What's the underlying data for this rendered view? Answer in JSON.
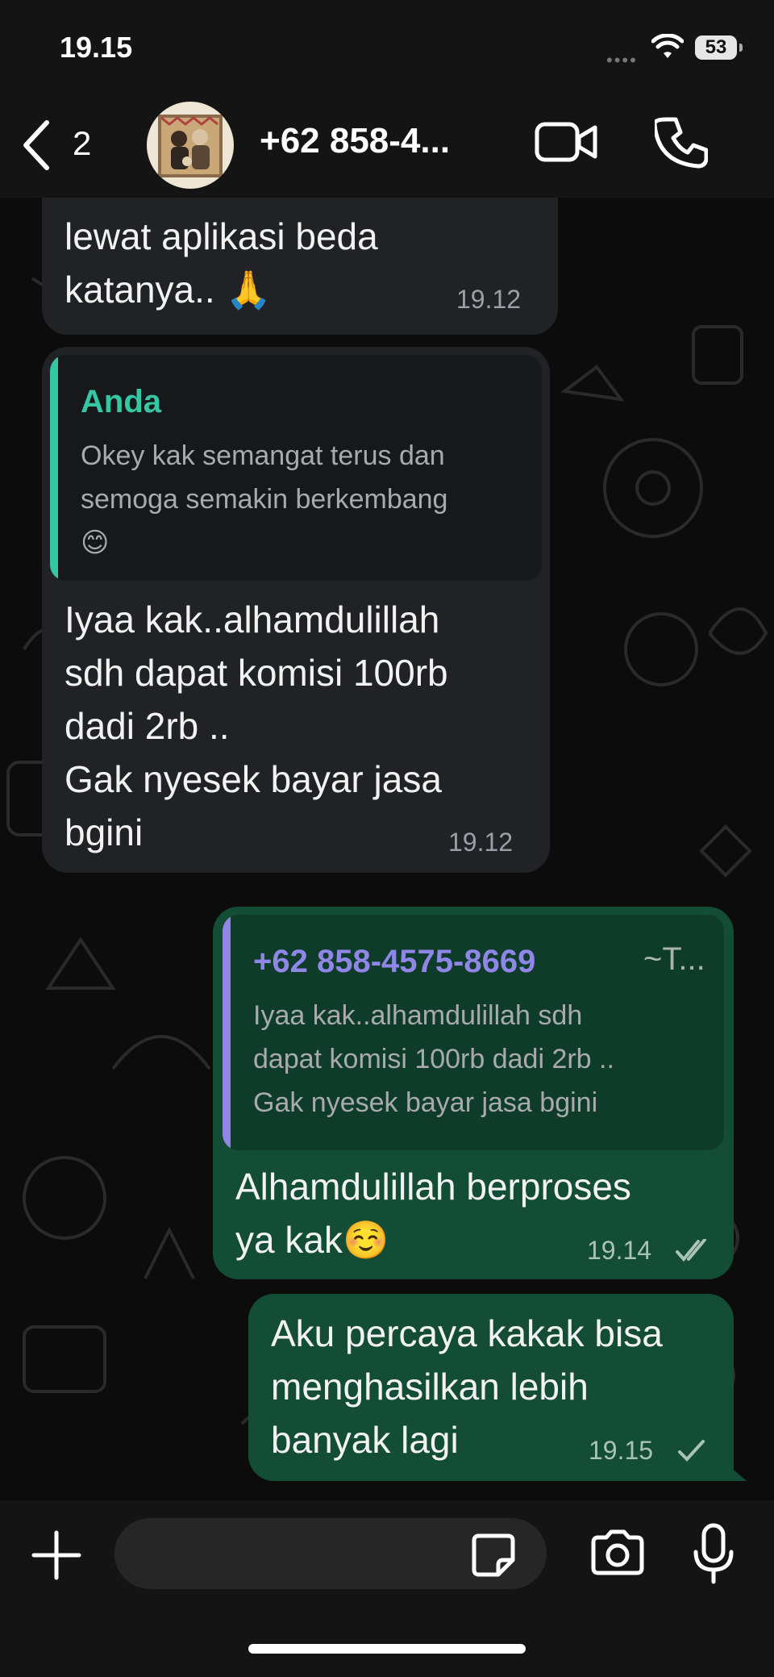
{
  "status_bar": {
    "time": "19.15",
    "battery": "53"
  },
  "header": {
    "back_count": "2",
    "title": "+62 858-4...",
    "icons": [
      "back-chevron-icon",
      "video-call-icon",
      "phone-call-icon"
    ]
  },
  "messages": [
    {
      "direction": "incoming",
      "text": "lewat aplikasi beda\nkatanya.. 🙏",
      "time": "19.12"
    },
    {
      "direction": "incoming",
      "quote": {
        "name": "Anda",
        "text": "Okey kak semangat terus dan\nsemoga semakin berkembang\n😊"
      },
      "text": "Iyaa kak..alhamdulillah\nsdh dapat komisi 100rb\ndadi 2rb ..\nGak nyesek bayar jasa\nbgini",
      "time": "19.12"
    },
    {
      "direction": "outgoing",
      "quote": {
        "name": "+62 858-4575-8669",
        "alias": "~T...",
        "text": "Iyaa kak..alhamdulillah sdh\ndapat komisi 100rb dadi 2rb ..\nGak nyesek bayar jasa bgini"
      },
      "text": "Alhamdulillah berproses\nya kak☺️",
      "time": "19.14",
      "status": "read-double-check-icon"
    },
    {
      "direction": "outgoing",
      "text": "Aku percaya kakak bisa\nmenghasilkan lebih\nbanyak lagi",
      "time": "19.15",
      "status": "sent-single-check-icon"
    }
  ],
  "composer": {
    "placeholder": "",
    "icons": [
      "plus-icon",
      "sticker-icon",
      "camera-icon",
      "microphone-icon"
    ]
  },
  "colors": {
    "incoming_bubble": "#202225",
    "outgoing_bubble": "#134d36",
    "quote_self_accent": "#35c6a4",
    "quote_contact_accent": "#8f86e8",
    "read_check": "#a9c4b7"
  }
}
